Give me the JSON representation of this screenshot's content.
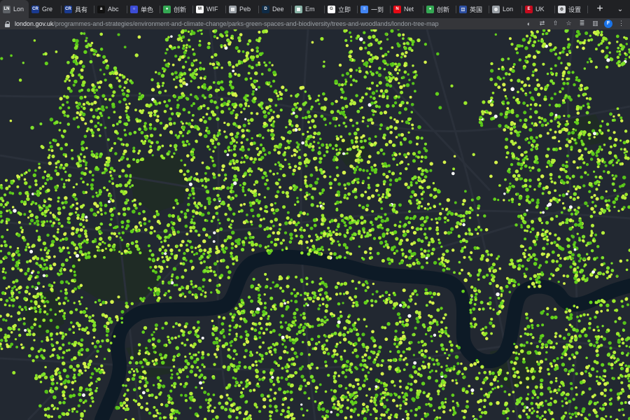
{
  "browser": {
    "tabs": [
      {
        "label": "Lon",
        "favicon": "london-gov-logo",
        "color": "#5f6368",
        "glyph": "LN",
        "active": true
      },
      {
        "label": "Gre",
        "favicon": "cr-logo",
        "color": "#1a3a8f",
        "glyph": "CR"
      },
      {
        "label": "具有",
        "favicon": "cr-logo",
        "color": "#1a3a8f",
        "glyph": "CR"
      },
      {
        "label": "Abc",
        "favicon": "abc-logo",
        "color": "#111111",
        "glyph": "a"
      },
      {
        "label": "单色",
        "favicon": "ring-icon",
        "color": "#3c4cd6",
        "glyph": "○"
      },
      {
        "label": "创新",
        "favicon": "map-pin-icon",
        "color": "#34a853",
        "glyph": "●"
      },
      {
        "label": "WIF",
        "favicon": "gmail-icon",
        "color": "#ffffff",
        "glyph": "M"
      },
      {
        "label": "Peb",
        "favicon": "doc-icon",
        "color": "#9aa0a6",
        "glyph": "▤"
      },
      {
        "label": "Dee",
        "favicon": "deepl-logo",
        "color": "#0f2b46",
        "glyph": "D"
      },
      {
        "label": "Em",
        "favicon": "image-icon",
        "color": "#8ab4a8",
        "glyph": "▦"
      },
      {
        "label": "立即",
        "favicon": "google-icon",
        "color": "#ffffff",
        "glyph": "G"
      },
      {
        "label": "一到",
        "favicon": "docs-icon",
        "color": "#4285f4",
        "glyph": "≡"
      },
      {
        "label": "Net",
        "favicon": "netflix-icon",
        "color": "#e50914",
        "glyph": "N"
      },
      {
        "label": "创新",
        "favicon": "map-pin-icon",
        "color": "#34a853",
        "glyph": "●"
      },
      {
        "label": "英国",
        "favicon": "shield-icon",
        "color": "#2d4fa1",
        "glyph": "◫"
      },
      {
        "label": "Lon",
        "favicon": "globe-icon",
        "color": "#9aa0a6",
        "glyph": "◍"
      },
      {
        "label": "UK",
        "favicon": "spain-flag-icon",
        "color": "#c60b1e",
        "glyph": "E"
      },
      {
        "label": "设置",
        "favicon": "gear-icon",
        "color": "#dadce0",
        "glyph": "⚙"
      }
    ],
    "new_tab_label": "+",
    "tab_list_label": "⌄",
    "address": {
      "host": "london.gov.uk",
      "path": "/programmes-and-strategies/environment-and-climate-change/parks-green-spaces-and-biodiversity/trees-and-woodlands/london-tree-map"
    },
    "profile_initial": "F"
  },
  "map": {
    "theme": "dark",
    "colors": {
      "background": "#222831",
      "water": "#0d1a26",
      "road": "#2a303a",
      "park": "#1f2b25",
      "tree_palette": [
        "#63d11b",
        "#7ee02a",
        "#9be82a",
        "#b6ee3a",
        "#d4f24a",
        "#56c21a"
      ]
    },
    "layer": "street trees",
    "features": [
      "river-thames",
      "parks",
      "streets",
      "tree-points"
    ]
  }
}
